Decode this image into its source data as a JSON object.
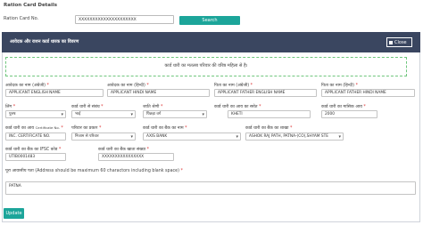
{
  "page": {
    "title": "Ration Card Details",
    "ration_card_label": "Ration Card No.",
    "ration_card_value": "XXXXXXXXXXXXXXXXXXXXX",
    "search_label": "Search"
  },
  "panel": {
    "title": "आवेदक और राशन कार्ड धारक का विवरण",
    "close_label": "Close",
    "notice": "कार्ड धारी का मतलब परिवार की वरिष्ठ महिला से है।"
  },
  "rows": {
    "row1": {
      "applicant_name_en": {
        "label": "आवेदक का नाम (अंग्रेजी)",
        "value": "APPLICANT ENGLISH NAME"
      },
      "applicant_name_hi": {
        "label": "आवेदक का नाम (हिन्दी)",
        "value": "APPLICANT HINDI NAME"
      },
      "father_name_en": {
        "label": "पिता का नाम (अंग्रेजी)",
        "value": "APPLICANT FATHER ENGLISH NAME"
      },
      "father_name_hi": {
        "label": "पिता का नाम (हिन्दी)",
        "value": "APPLICANT FATHER HINDI NAME"
      }
    },
    "row2": {
      "gender": {
        "label": "लिंग",
        "value": "पुरुष"
      },
      "relation": {
        "label": "कार्ड धारी से संबंध",
        "value": "भाई"
      },
      "caste": {
        "label": "जाति श्रेणी",
        "value": "पिछड़ा वर्ग"
      },
      "income_source": {
        "label": "कार्ड धारी का आय का स्त्रोत",
        "value": "KHETI"
      },
      "monthly_income": {
        "label": "कार्ड धारी का मासिक आय",
        "value": "2000"
      }
    },
    "row3": {
      "cert_no": {
        "label": "कार्ड धारी का आय ",
        "label_small": "Certificate No.",
        "value": "INC. CERTIFICATE NO."
      },
      "family_type": {
        "label": "परिवार का प्रकार",
        "value": "निजाम से परिवार"
      },
      "bank_name": {
        "label": "कार्ड धारी का बैंक का नाम",
        "value": "AXIS BANK"
      },
      "bank_branch": {
        "label": "कार्ड धारी का बैंक का शाखा",
        "value": "ASHOK RAJ PATH, PATNA-(CO),SHYAM STE"
      }
    },
    "row4": {
      "ifsc": {
        "label": "कार्ड धारी का बैंक का IFSC कोड",
        "value": "UTIB0001483"
      },
      "account": {
        "label": "कार्ड धारी का बैंक खाता संख्या",
        "value": "XXXXXXXXXXXXXXXX"
      }
    }
  },
  "address": {
    "label": "पूरा आवासीय पता (Address should be maximum 60 charactors including blank space)",
    "value": "PATNA"
  },
  "update_label": "Update"
}
